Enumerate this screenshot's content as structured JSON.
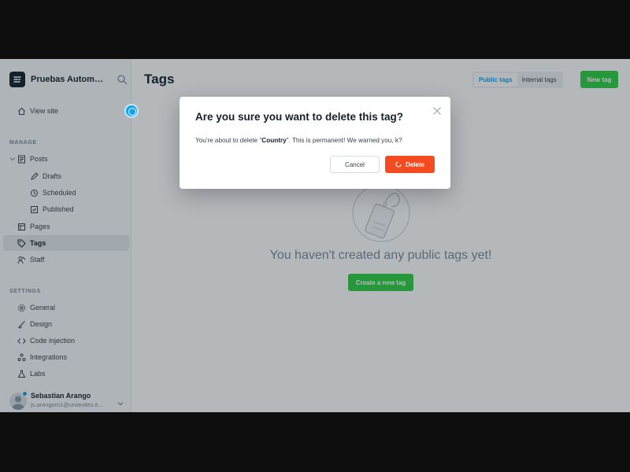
{
  "sidebar": {
    "brand": {
      "name": "Pruebas Automati...",
      "logo_icon": "ghost-logo-icon",
      "search_icon": "search-icon"
    },
    "view_site": {
      "label": "View site",
      "icon": "home-icon"
    },
    "manage_title": "MANAGE",
    "manage_items": [
      {
        "label": "Posts",
        "icon": "posts-icon"
      },
      {
        "label": "Drafts",
        "icon": "pencil-icon"
      },
      {
        "label": "Scheduled",
        "icon": "clock-icon"
      },
      {
        "label": "Published",
        "icon": "published-icon"
      },
      {
        "label": "Pages",
        "icon": "pages-icon"
      },
      {
        "label": "Tags",
        "icon": "tag-icon",
        "active": true
      },
      {
        "label": "Staff",
        "icon": "staff-icon"
      }
    ],
    "settings_title": "SETTINGS",
    "settings_items": [
      {
        "label": "General",
        "icon": "gear-icon"
      },
      {
        "label": "Design",
        "icon": "brush-icon"
      },
      {
        "label": "Code injection",
        "icon": "code-icon"
      },
      {
        "label": "Integrations",
        "icon": "integrations-icon"
      },
      {
        "label": "Labs",
        "icon": "flask-icon"
      }
    ],
    "user": {
      "name": "Sebastian Arango",
      "email": "js.arangom1@uniandes.e..."
    }
  },
  "main": {
    "title": "Tags",
    "tabs": [
      {
        "label": "Public tags",
        "active": true
      },
      {
        "label": "Internal tags",
        "active": false
      }
    ],
    "new_tag_label": "New tag",
    "empty_message": "You haven't created any public tags yet!",
    "create_label": "Create a new tag"
  },
  "modal": {
    "title": "Are you sure you want to delete this tag?",
    "body_prefix": "You're about to delete \"",
    "tag_name": "Country",
    "body_suffix": "\". This is permanent! We warned you, k?",
    "cancel_label": "Cancel",
    "delete_label": "Delete"
  },
  "colors": {
    "accent_blue": "#14a2f0",
    "green": "#30cf43",
    "red": "#f44c20",
    "dark": "#15212a"
  }
}
